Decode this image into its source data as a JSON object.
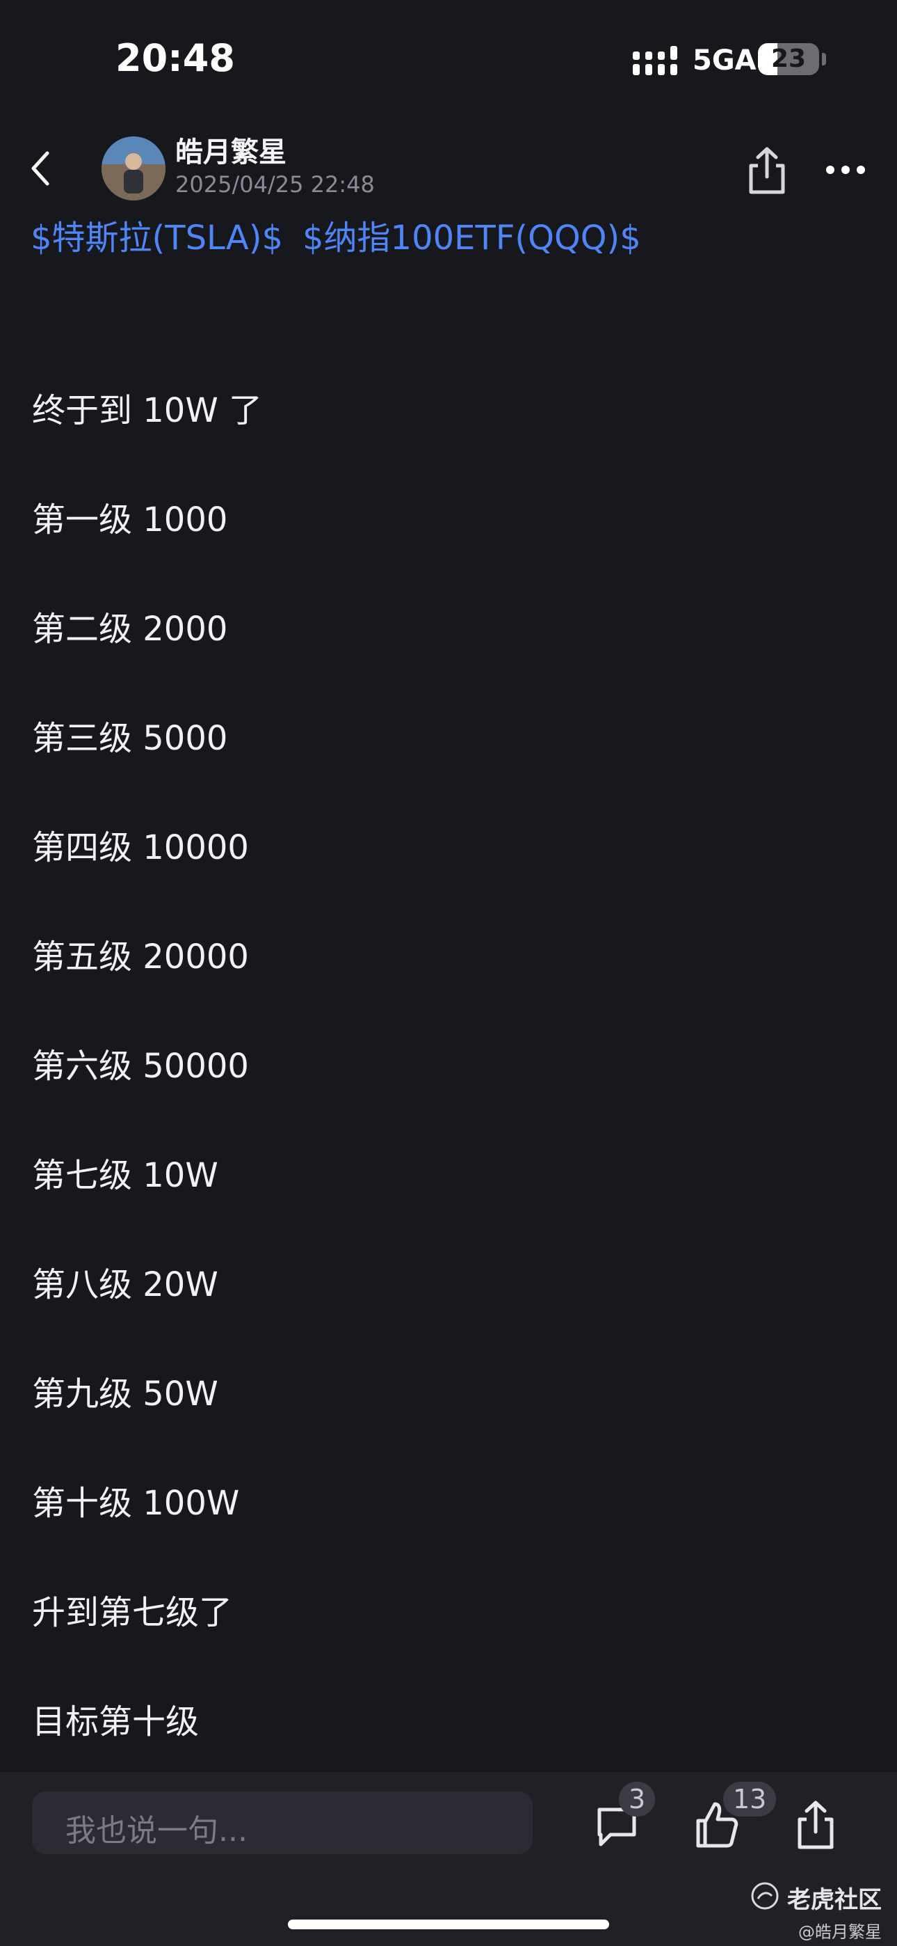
{
  "status_bar": {
    "time": "20:48",
    "network": "5GA",
    "battery": "23"
  },
  "header": {
    "author": "皓月繁星",
    "timestamp": "2025/04/25 22:48"
  },
  "post": {
    "tags": [
      "$特斯拉(TSLA)$",
      "$纳指100ETF(QQQ)$"
    ],
    "lines": [
      "终于到 10W 了",
      "第一级 1000",
      "第二级 2000",
      "第三级 5000",
      "第四级 10000",
      "第五级 20000",
      "第六级 50000",
      "第七级 10W",
      "第八级 20W",
      "第九级 50W",
      "第十级 100W",
      "升到第七级了",
      "目标第十级"
    ]
  },
  "bottom_bar": {
    "comment_placeholder": "我也说一句...",
    "comment_count": "3",
    "like_count": "13"
  },
  "watermark": {
    "brand": "老虎社区",
    "user": "@皓月繁星"
  },
  "colors": {
    "background": "#17181d",
    "tag_link": "#4f86f7",
    "bottom_bar": "#202127"
  }
}
